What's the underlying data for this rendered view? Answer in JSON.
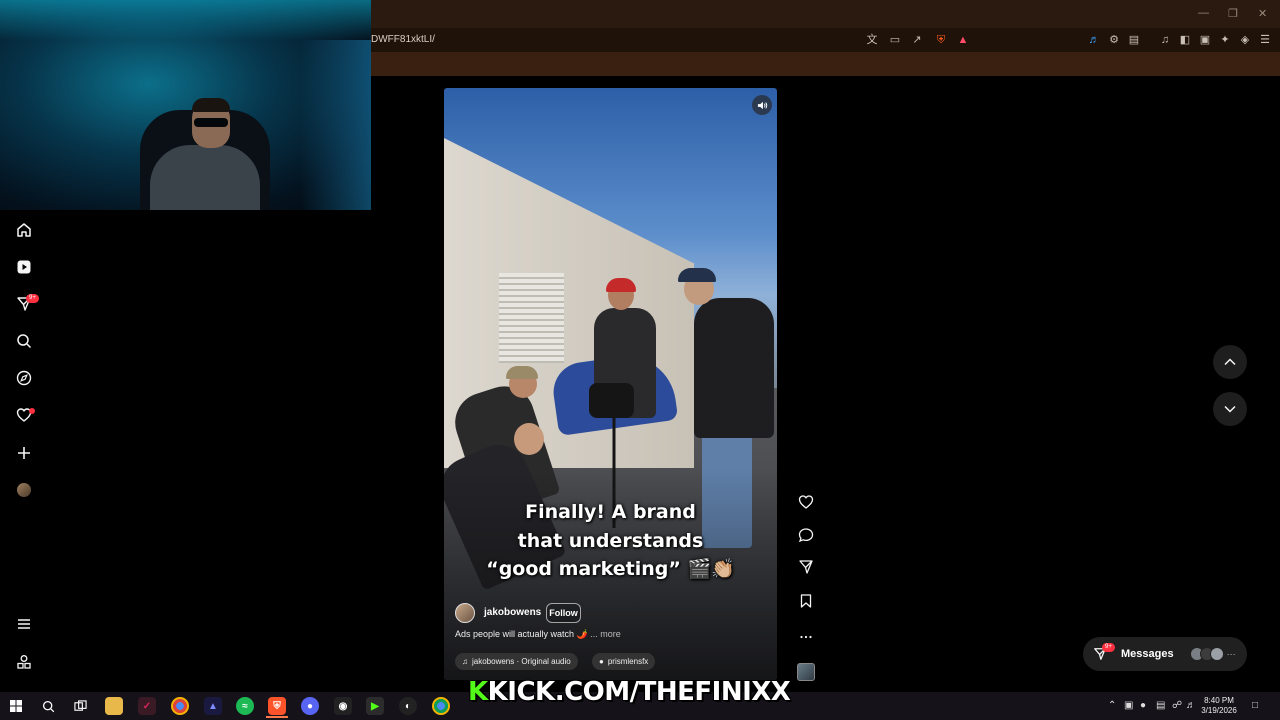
{
  "browser": {
    "url": "DWFF81xktLI/",
    "accent": "#2b1a10"
  },
  "reel": {
    "caption_lines": [
      "Finally! A brand",
      "that understands",
      "“good marketing” 🎬👏🏼"
    ],
    "author": "jakobowens",
    "follow_label": "Follow",
    "description": "Ads people will actually watch 🌶️",
    "more_label": "... more",
    "audio": "jakobowens · Original audio",
    "collaborator": "prismlensfx"
  },
  "nav": {
    "notification_badge": "9+",
    "icons": [
      "home-icon",
      "reels-icon",
      "messages-icon",
      "search-icon",
      "explore-icon",
      "notifications-icon",
      "create-icon",
      "profile-avatar",
      "menu-icon",
      "more-apps-icon"
    ]
  },
  "messages": {
    "label": "Messages",
    "badge": "9+"
  },
  "overlay": {
    "kick_k": "K",
    "kick_text": "KICK.COM/THEFINIXX"
  },
  "taskbar": {
    "time": "8:40 PM",
    "date": "3/19/2026"
  },
  "colors": {
    "badge": "#ff3040",
    "kick_green": "#53fc18"
  }
}
